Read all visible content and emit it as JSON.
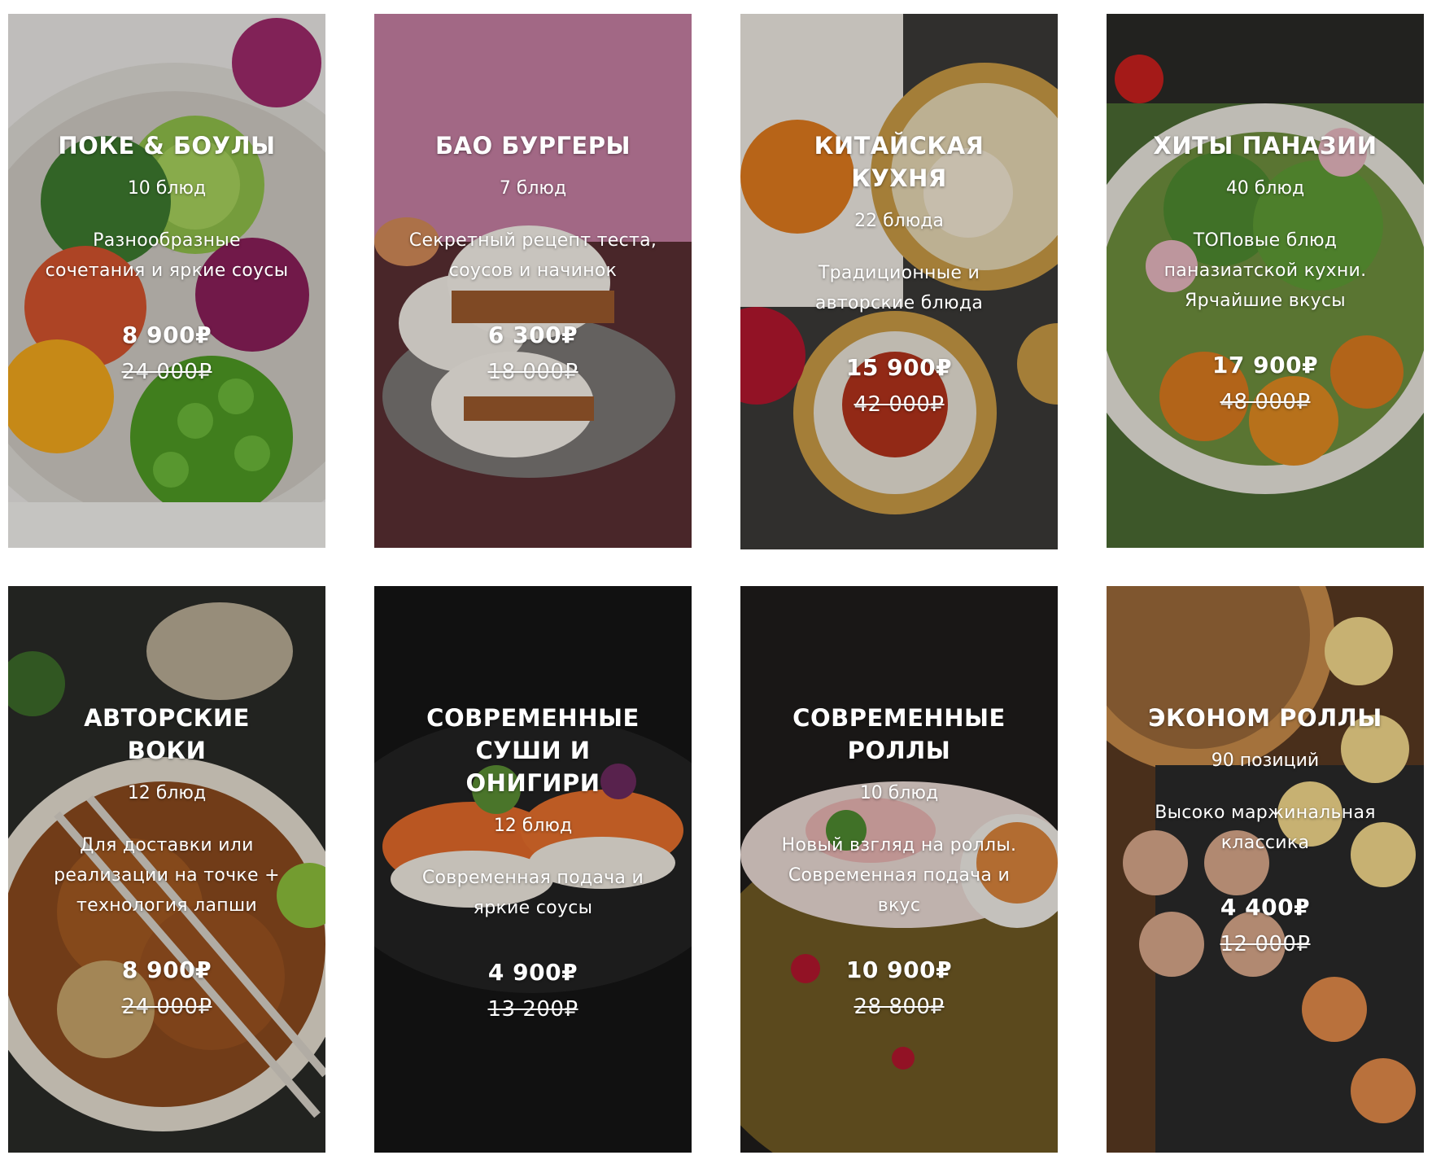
{
  "cards": [
    {
      "title": "ПОКЕ & БОУЛЫ",
      "count": "10 блюд",
      "description": "Разнообразные сочетания и яркие соусы",
      "price": "8 900₽",
      "old_price": "24 000₽",
      "image": "poke-bowl-photo"
    },
    {
      "title": "БАО БУРГЕРЫ",
      "count": "7 блюд",
      "description": "Секретный рецепт теста, соусов и начинок",
      "price": "6 300₽",
      "old_price": "18 000₽",
      "image": "bao-burger-photo"
    },
    {
      "title": "КИТАЙСКАЯ КУХНЯ",
      "count": "22 блюда",
      "description": "Традиционные и авторские блюда",
      "price": "15 900₽",
      "old_price": "42 000₽",
      "image": "dim-sum-photo"
    },
    {
      "title": "ХИТЫ ПАНАЗИИ",
      "count": "40 блюд",
      "description": "ТОПовые блюд паназиатской кухни. Ярчайшие вкусы",
      "price": "17 900₽",
      "old_price": "48 000₽",
      "image": "panasian-salad-photo"
    },
    {
      "title": "АВТОРСКИЕ ВОКИ",
      "count": "12 блюд",
      "description": "Для доставки или реализации на точке + технология лапши",
      "price": "8 900₽",
      "old_price": "24 000₽",
      "image": "wok-noodles-photo"
    },
    {
      "title": "СОВРЕМЕННЫЕ СУШИ И ОНИГИРИ",
      "count": "12 блюд",
      "description": "Современная подача и яркие соусы",
      "price": "4 900₽",
      "old_price": "13 200₽",
      "image": "sushi-photo"
    },
    {
      "title": "СОВРЕМЕННЫЕ РОЛЛЫ",
      "count": "10 блюд",
      "description": "Новый взгляд на роллы. Современная подача и вкус",
      "price": "10 900₽",
      "old_price": "28 800₽",
      "image": "spring-rolls-photo"
    },
    {
      "title": "ЭКОНОМ РОЛЛЫ",
      "count": "90 позиций",
      "description": "Высоко маржинальная классика",
      "price": "4 400₽",
      "old_price": "12 000₽",
      "image": "econom-rolls-photo"
    }
  ]
}
